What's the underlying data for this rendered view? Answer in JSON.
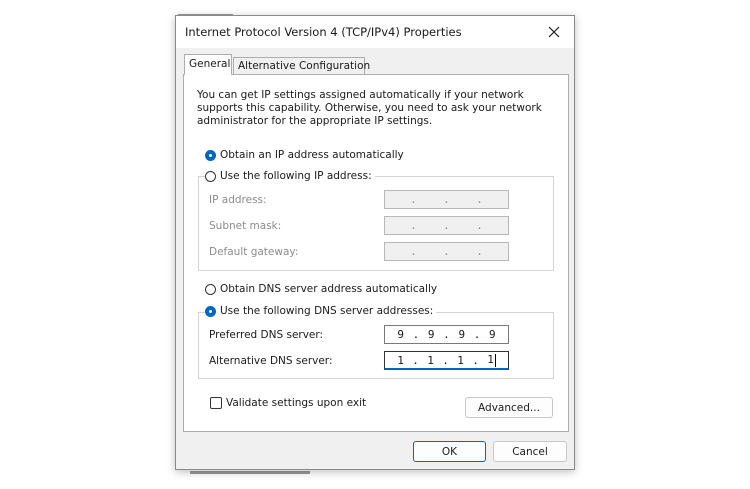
{
  "window": {
    "title": "Internet Protocol Version 4 (TCP/IPv4) Properties"
  },
  "tabs": [
    {
      "label": "General",
      "selected": true
    },
    {
      "label": "Alternative Configuration",
      "selected": false
    }
  ],
  "intro_text": "You can get IP settings assigned automatically if your network supports this capability. Otherwise, you need to ask your network administrator for the appropriate IP settings.",
  "ip": {
    "auto_label": "Obtain an IP address automatically",
    "auto_selected": true,
    "manual_label": "Use the following IP address:",
    "manual_selected": false,
    "fields": [
      {
        "label": "IP address:",
        "value": ".    .    ."
      },
      {
        "label": "Subnet mask:",
        "value": ".    .    ."
      },
      {
        "label": "Default gateway:",
        "value": ".    .    ."
      }
    ]
  },
  "dns": {
    "auto_label": "Obtain DNS server address automatically",
    "auto_selected": false,
    "manual_label": "Use the following DNS server addresses:",
    "manual_selected": true,
    "preferred_label": "Preferred DNS server:",
    "preferred_octets": [
      "9",
      ".",
      "9",
      ".",
      "9",
      ".",
      "9"
    ],
    "alternate_label": "Alternative DNS server:",
    "alternate_octets": [
      "1",
      ".",
      "1",
      ".",
      "1",
      ".",
      "1"
    ]
  },
  "validate": {
    "label": "Validate settings upon exit",
    "checked": false
  },
  "buttons": {
    "advanced": "Advanced...",
    "ok": "OK",
    "cancel": "Cancel"
  },
  "colors": {
    "accent": "#0067c0",
    "window_bg": "#f0f0f0",
    "panel_bg": "#ffffff"
  }
}
